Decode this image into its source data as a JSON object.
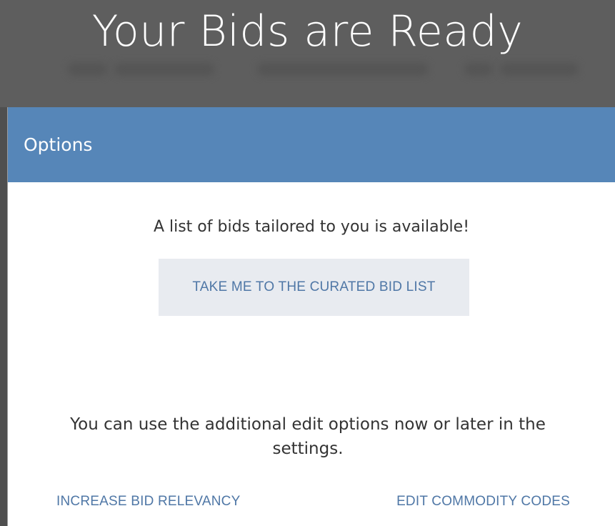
{
  "backdrop": {
    "headline": "Your Bids are Ready"
  },
  "dialog": {
    "title": "Options",
    "available_message": "A list of bids tailored to you is available!",
    "curated_button_label": "TAKE ME TO THE CURATED BID LIST",
    "hint_message": "You can use the additional edit options now or later in the settings.",
    "links": {
      "increase_relevancy": "INCREASE BID RELEVANCY",
      "edit_commodity_codes": "EDIT COMMODITY CODES"
    }
  },
  "colors": {
    "header_bg": "#5686b8",
    "link": "#4f77a6",
    "button_bg": "#e8ebf0",
    "backdrop": "#5e5e5e"
  }
}
